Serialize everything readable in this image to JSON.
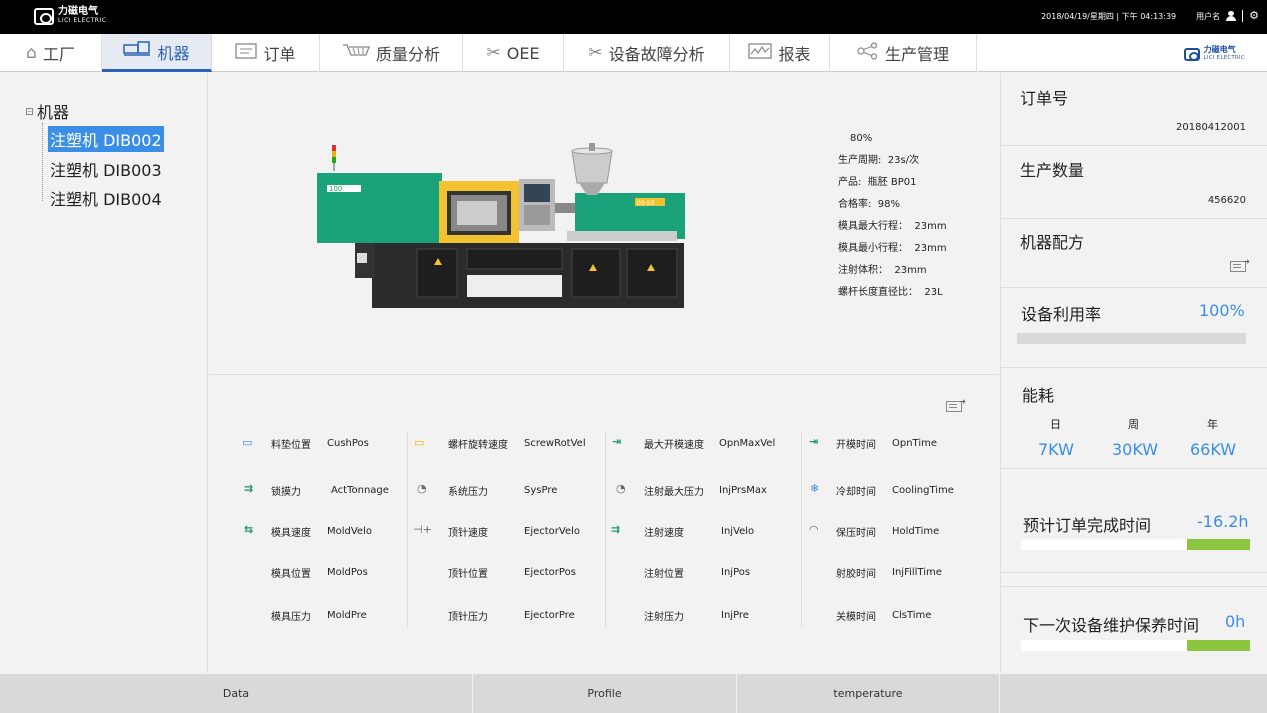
{
  "topbar": {
    "logo_cn": "力磁电气",
    "logo_en": "LICI ELECTRIC",
    "datetime": "2018/04/19/星期四 | 下午 04:13:39",
    "username": "用户名"
  },
  "nav": {
    "items": [
      {
        "label": "工厂",
        "icon": "home-icon"
      },
      {
        "label": "机器",
        "icon": "machine-icon"
      },
      {
        "label": "订单",
        "icon": "order-icon"
      },
      {
        "label": "质量分析",
        "icon": "quality-icon"
      },
      {
        "label": "OEE",
        "icon": "tools-icon"
      },
      {
        "label": "设备故障分析",
        "icon": "wrench-icon"
      },
      {
        "label": "报表",
        "icon": "chart-icon"
      },
      {
        "label": "生产管理",
        "icon": "share-icon"
      }
    ],
    "active_index": 1
  },
  "tree": {
    "root": "机器",
    "items": [
      "注塑机 DIB002",
      "注塑机 DIB003",
      "注塑机 DIB004"
    ],
    "selected_index": 0
  },
  "machine": {
    "label_big": "100",
    "label_small": "00-SS",
    "specs": [
      {
        "label": "",
        "value": "80%"
      },
      {
        "label": "生产周期:",
        "value": "23s/次"
      },
      {
        "label": "产品:",
        "value": "瓶胚 BP01"
      },
      {
        "label": "合格率:",
        "value": "98%"
      },
      {
        "label": "模具最大行程：",
        "value": "23mm"
      },
      {
        "label": "模具最小行程：",
        "value": "23mm"
      },
      {
        "label": "注射体积：",
        "value": "23mm"
      },
      {
        "label": "螺杆长度直径比：",
        "value": "23L"
      }
    ]
  },
  "params": {
    "col1": [
      {
        "cn": "料垫位置",
        "en": "CushPos"
      },
      {
        "cn": "锁摸力",
        "en": "ActTonnage"
      },
      {
        "cn": "模具速度",
        "en": "MoldVelo"
      },
      {
        "cn": "模具位置",
        "en": "MoldPos"
      },
      {
        "cn": "模具压力",
        "en": "MoldPre"
      }
    ],
    "col2": [
      {
        "cn": "螺杆旋转速度",
        "en": "ScrewRotVel"
      },
      {
        "cn": "系统压力",
        "en": "SysPre"
      },
      {
        "cn": "顶针速度",
        "en": "EjectorVelo"
      },
      {
        "cn": "顶针位置",
        "en": "EjectorPos"
      },
      {
        "cn": "顶针压力",
        "en": "EjectorPre"
      }
    ],
    "col3": [
      {
        "cn": "最大开模速度",
        "en": "OpnMaxVel"
      },
      {
        "cn": "注射最大压力",
        "en": "InjPrsMax"
      },
      {
        "cn": "注射速度",
        "en": "InjVelo"
      },
      {
        "cn": "注射位置",
        "en": "InjPos"
      },
      {
        "cn": "注射压力",
        "en": "InjPre"
      }
    ],
    "col4": [
      {
        "cn": "开模时间",
        "en": "OpnTime"
      },
      {
        "cn": "冷却时间",
        "en": "CoolingTime"
      },
      {
        "cn": "保压时间",
        "en": "HoldTime"
      },
      {
        "cn": "射胶时间",
        "en": "InjFillTime"
      },
      {
        "cn": "关模时间",
        "en": "ClsTime"
      }
    ]
  },
  "right": {
    "order_title": "订单号",
    "order_value": "20180412001",
    "qty_title": "生产数量",
    "qty_value": "456620",
    "recipe_title": "机器配方",
    "util_title": "设备利用率",
    "util_value": "100%",
    "util_fraction": 1.0,
    "energy_title": "能耗",
    "energy": [
      {
        "label": "日",
        "value": "7KW"
      },
      {
        "label": "周",
        "value": "30KW"
      },
      {
        "label": "年",
        "value": "66KW"
      }
    ],
    "eta_title": "预计订单完成时间",
    "eta_value": "-16.2h",
    "maint_title": "下一次设备维护保养时间",
    "maint_value": "0h"
  },
  "footer": {
    "tabs": [
      "Data",
      "Profile",
      "temperature"
    ]
  },
  "colors": {
    "accent": "#3a8ee6",
    "nav_active": "#2a63b6",
    "progress": "#8cc63f",
    "machine_green": "#1aa37a",
    "machine_yellow": "#f2c230"
  }
}
